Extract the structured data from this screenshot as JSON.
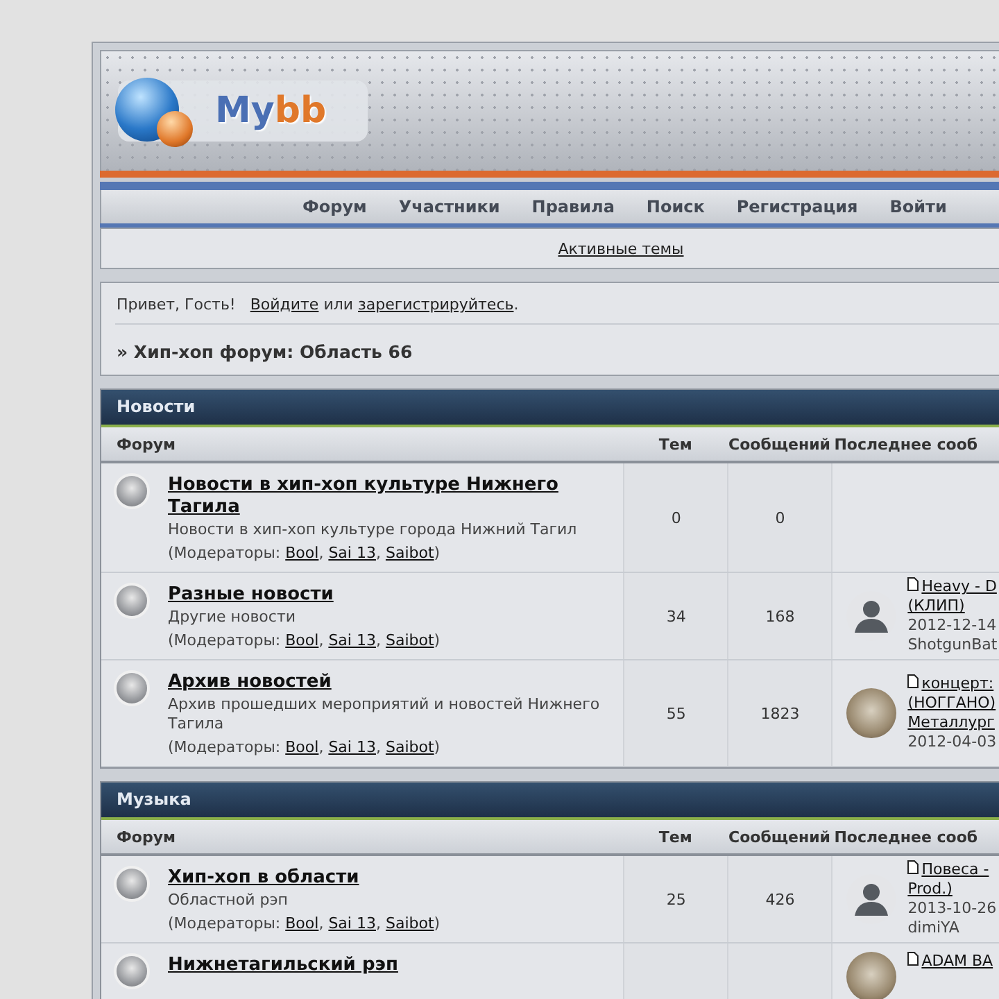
{
  "header": {
    "logo": [
      {
        "text": "My",
        "color": "#4a6fb4"
      },
      {
        "text": "bb",
        "color": "#e0782a"
      }
    ]
  },
  "nav": [
    "Форум",
    "Участники",
    "Правила",
    "Поиск",
    "Регистрация",
    "Войти"
  ],
  "subnav": {
    "link": "Активные темы"
  },
  "welcome": {
    "greeting": "Привет, Гость!",
    "login": "Войдите",
    "or": "или",
    "register": "зарегистрируйтесь",
    "end": "."
  },
  "breadcrumb": "» Хип-хоп форум: Область 66",
  "categories": [
    {
      "title": "Новости",
      "columns": [
        "Форум",
        "Тем",
        "Сообщений",
        "Последнее сооб"
      ],
      "forums": [
        {
          "title": "Новости в хип-хоп культуре Нижнего Тагила",
          "description": "Новости в хип-хоп культуре города Нижний Тагил",
          "mod_prefix": "(Модераторы: ",
          "moderators": [
            "Bool",
            "Sai 13",
            "Saibot"
          ],
          "separator": ", ",
          "mod_suffix": ")",
          "topics": "0",
          "posts": "0"
        },
        {
          "title": "Разные новости",
          "description": "Другие новости",
          "mod_prefix": "(Модераторы: ",
          "moderators": [
            "Bool",
            "Sai 13",
            "Saibot"
          ],
          "separator": ", ",
          "mod_suffix": ")",
          "topics": "34",
          "posts": "168",
          "last_post": {
            "kind": "silhouette",
            "title_lines": [
              "Heavy - D",
              "(КЛИП)"
            ],
            "date": "2012-12-14",
            "author": "ShotgunBat"
          }
        },
        {
          "title": "Архив новостей",
          "description": "Архив прошедших мероприятий и новостей Нижнего Тагила",
          "mod_prefix": "(Модераторы: ",
          "moderators": [
            "Bool",
            "Sai 13",
            "Saibot"
          ],
          "separator": ", ",
          "mod_suffix": ")",
          "topics": "55",
          "posts": "1823",
          "last_post": {
            "kind": "photo",
            "title_lines": [
              "концерт:",
              "(НОГГАНО)",
              "Металлург"
            ],
            "date": "2012-04-03"
          }
        }
      ]
    },
    {
      "title": "Музыка",
      "columns": [
        "Форум",
        "Тем",
        "Сообщений",
        "Последнее сооб"
      ],
      "forums": [
        {
          "title": "Хип-хоп в области",
          "description": "Областной рэп",
          "mod_prefix": "(Модераторы: ",
          "moderators": [
            "Bool",
            "Sai 13",
            "Saibot"
          ],
          "separator": ", ",
          "mod_suffix": ")",
          "topics": "25",
          "posts": "426",
          "last_post": {
            "kind": "silhouette",
            "title_lines": [
              "Повеса -",
              "Prod.)"
            ],
            "date": "2013-10-26",
            "author": "dimiYA"
          }
        },
        {
          "title": "Нижнетагильский рэп",
          "last_post": {
            "kind": "photo",
            "title_lines": [
              "ADAM BA"
            ]
          }
        }
      ]
    }
  ]
}
